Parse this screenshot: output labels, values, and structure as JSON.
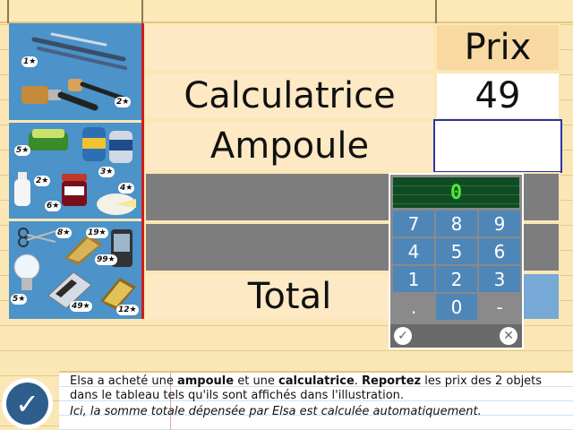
{
  "table": {
    "header_price": "Prix",
    "rows": [
      {
        "label": "Calculatrice",
        "price": "49"
      },
      {
        "label": "Ampoule",
        "price": ""
      }
    ],
    "total_label": "Total"
  },
  "illustration": {
    "badges": [
      "1★",
      "2★",
      "5★",
      "3★",
      "2★",
      "6★",
      "4★",
      "8★",
      "19★",
      "99★",
      "5★",
      "49★",
      "12★"
    ]
  },
  "keypad": {
    "display": "0",
    "keys": [
      "7",
      "8",
      "9",
      "4",
      "5",
      "6",
      "1",
      "2",
      "3",
      ".",
      "0",
      "-"
    ],
    "ok_icon": "check-circle-icon",
    "clear_icon": "close-circle-icon"
  },
  "instructions": {
    "line1_a": "Elsa a acheté une ",
    "line1_b": "ampoule",
    "line1_c": " et une ",
    "line1_d": "calculatrice",
    "line1_e": ". ",
    "line1_f": "Reportez",
    "line1_g": " les prix des 2 objets dans le tableau tels qu'ils sont affichés dans l'illustration.",
    "line2": "Ici, la somme totale dépensée par Elsa est calculée automatiquement."
  },
  "colors": {
    "accent_blue": "#4b93c8",
    "keypad_key": "#4f86b8",
    "display_green": "#4eea3a",
    "input_border": "#2b34a8"
  }
}
